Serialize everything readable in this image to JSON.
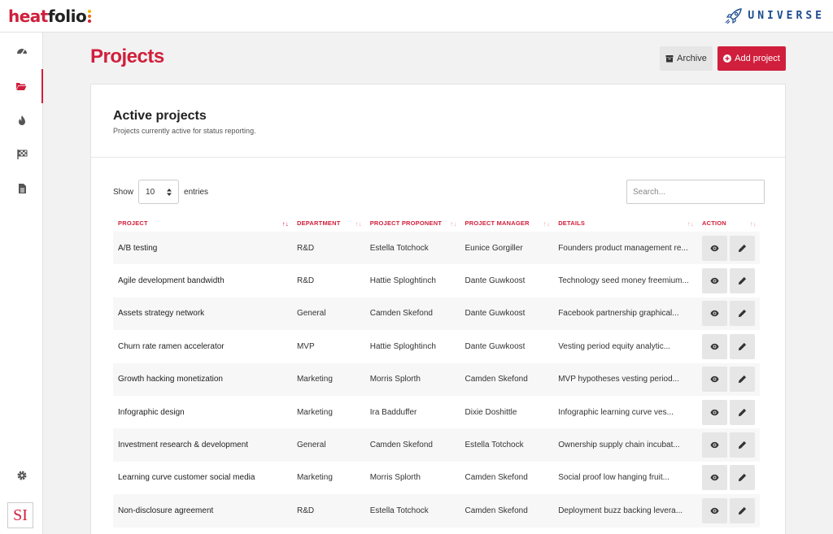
{
  "app": {
    "logo_part1": "heat",
    "logo_part2": "folio",
    "brand": "UNIVERSE",
    "org_initials": "SI"
  },
  "colors": {
    "accent": "#d01f3c",
    "brand_blue": "#1e4c8f"
  },
  "sidebar": {
    "items": [
      {
        "icon": "dashboard-icon"
      },
      {
        "icon": "folder-open-icon",
        "active": true
      },
      {
        "icon": "fire-icon"
      },
      {
        "icon": "flag-checkered-icon"
      },
      {
        "icon": "file-alt-icon"
      }
    ],
    "settings_icon": "gear-icon"
  },
  "header": {
    "title": "Projects",
    "archive_label": "Archive",
    "add_label": "Add project"
  },
  "card": {
    "title": "Active projects",
    "subtitle": "Projects currently active for status reporting."
  },
  "controls": {
    "show_label": "Show",
    "entries_value": "10",
    "entries_label": "entries",
    "search_placeholder": "Search..."
  },
  "table": {
    "columns": [
      "Project",
      "Department",
      "Project Proponent",
      "Project Manager",
      "Details",
      "Action"
    ],
    "rows": [
      [
        "A/B testing",
        "R&D",
        "Estella Totchock",
        "Eunice Gorgiller",
        "Founders product management re..."
      ],
      [
        "Agile development bandwidth",
        "R&D",
        "Hattie Sploghtinch",
        "Dante Guwkoost",
        "Technology seed money freemium..."
      ],
      [
        "Assets strategy network",
        "General",
        "Camden Skefond",
        "Dante Guwkoost",
        "Facebook partnership graphical..."
      ],
      [
        "Churn rate ramen accelerator",
        "MVP",
        "Hattie Sploghtinch",
        "Dante Guwkoost",
        "Vesting period equity analytic..."
      ],
      [
        "Growth hacking monetization",
        "Marketing",
        "Morris Splorth",
        "Camden Skefond",
        "MVP hypotheses vesting period..."
      ],
      [
        "Infographic design",
        "Marketing",
        "Ira Badduffer",
        "Dixie Doshittle",
        "Infographic learning curve ves..."
      ],
      [
        "Investment research & development",
        "General",
        "Camden Skefond",
        "Estella Totchock",
        "Ownership supply chain incubat..."
      ],
      [
        "Learning curve customer social media",
        "Marketing",
        "Morris Splorth",
        "Camden Skefond",
        "Social proof low hanging fruit..."
      ],
      [
        "Non-disclosure agreement",
        "R&D",
        "Estella Totchock",
        "Camden Skefond",
        "Deployment buzz backing levera..."
      ]
    ]
  }
}
